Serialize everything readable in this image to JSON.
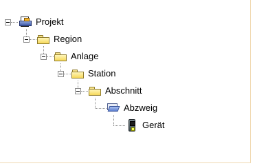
{
  "tree": {
    "nodes": [
      {
        "label": "Projekt",
        "icon": "project-icon",
        "expanded": true
      },
      {
        "label": "Region",
        "icon": "folder-icon",
        "expanded": true
      },
      {
        "label": "Anlage",
        "icon": "folder-icon",
        "expanded": true
      },
      {
        "label": "Station",
        "icon": "folder-icon",
        "expanded": true
      },
      {
        "label": "Abschnitt",
        "icon": "folder-icon",
        "expanded": true
      },
      {
        "label": "Abzweig",
        "icon": "folder-open-icon",
        "expanded": false
      },
      {
        "label": "Gerät",
        "icon": "device-icon",
        "expanded": false
      }
    ]
  }
}
